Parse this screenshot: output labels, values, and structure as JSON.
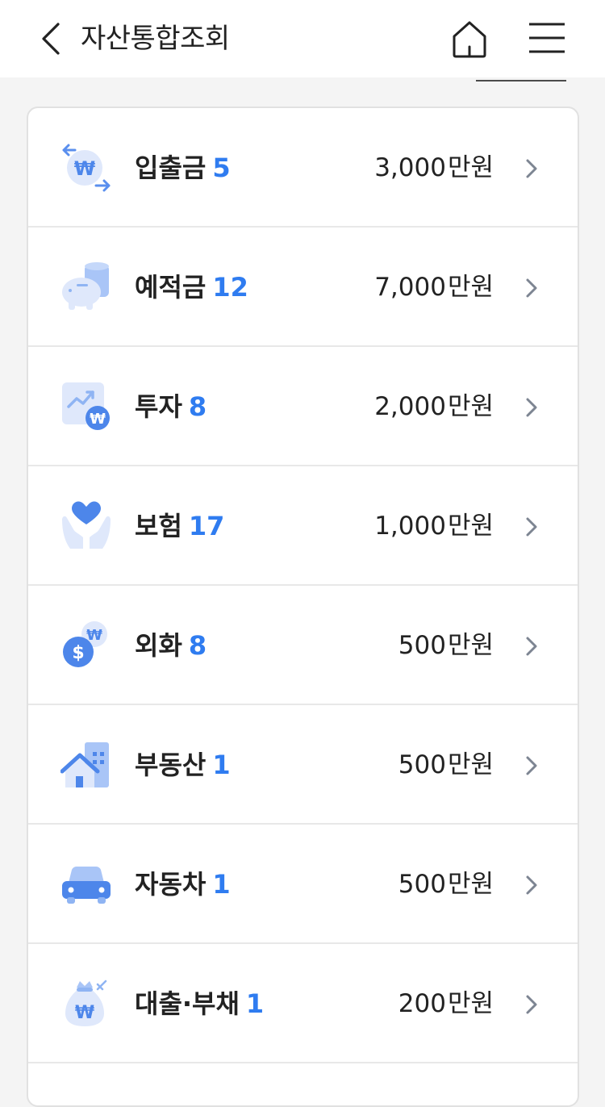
{
  "header": {
    "title": "자산통합조회"
  },
  "assets": [
    {
      "label": "입출금",
      "count": "5",
      "amount": "3,000",
      "unit": "만원",
      "icon": "deposit-withdraw-icon"
    },
    {
      "label": "예적금",
      "count": "12",
      "amount": "7,000",
      "unit": "만원",
      "icon": "savings-icon"
    },
    {
      "label": "투자",
      "count": "8",
      "amount": "2,000",
      "unit": "만원",
      "icon": "investment-icon"
    },
    {
      "label": "보험",
      "count": "17",
      "amount": "1,000",
      "unit": "만원",
      "icon": "insurance-icon"
    },
    {
      "label": "외화",
      "count": "8",
      "amount": "500",
      "unit": "만원",
      "icon": "foreign-currency-icon"
    },
    {
      "label": "부동산",
      "count": "1",
      "amount": "500",
      "unit": "만원",
      "icon": "real-estate-icon"
    },
    {
      "label": "자동차",
      "count": "1",
      "amount": "500",
      "unit": "만원",
      "icon": "car-icon"
    },
    {
      "label": "대출·부채",
      "count": "1",
      "amount": "200",
      "unit": "만원",
      "icon": "loan-icon"
    }
  ],
  "colors": {
    "accent": "#2f7cf0",
    "icon_light": "#dfe8fb",
    "icon_mid": "#8fb4f3",
    "icon_dark": "#4d86ea"
  }
}
